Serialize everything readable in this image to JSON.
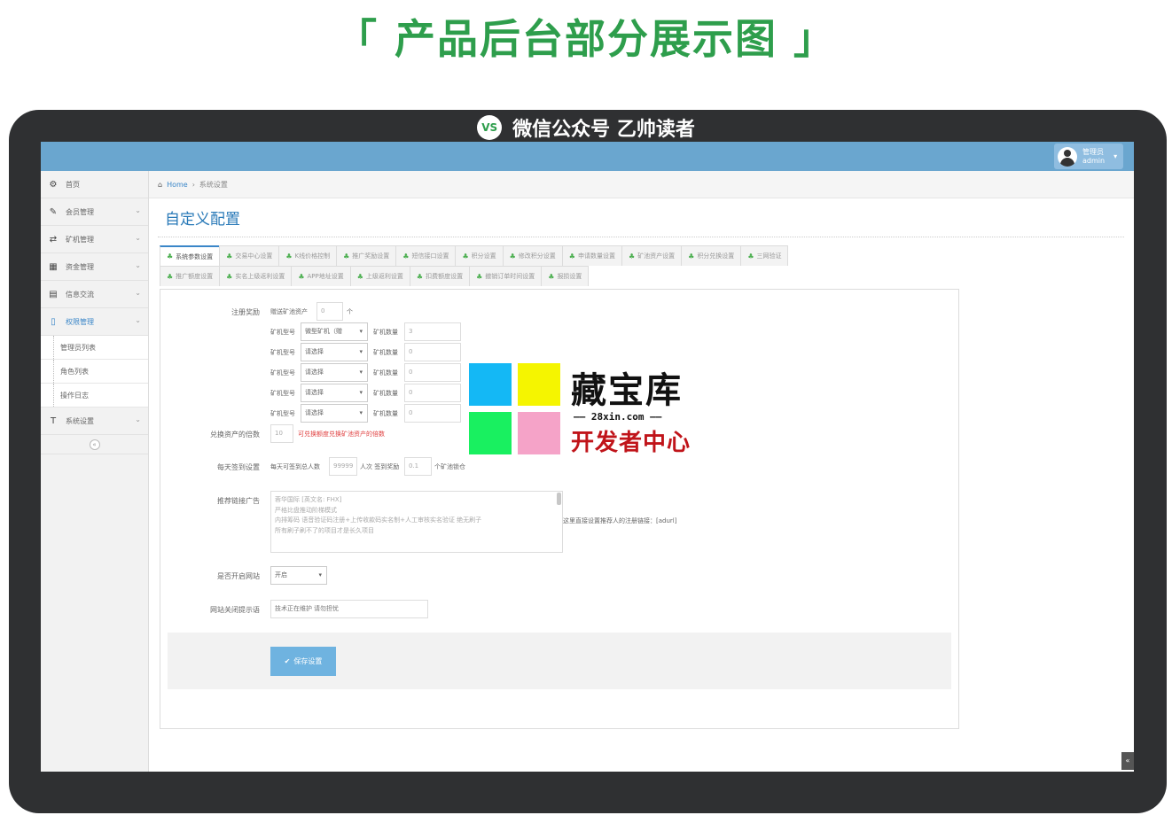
{
  "headline": "「 产品后台部分展示图 」",
  "brand": {
    "logo_text": "VS",
    "name": "微信公众号 乙帅读者"
  },
  "header": {
    "user_role": "管理员",
    "user_name": "admin"
  },
  "sidebar": {
    "items": [
      {
        "label": "首页",
        "icon": "dashboard-icon",
        "glyph": "⚙"
      },
      {
        "label": "会员管理",
        "icon": "edit-icon",
        "glyph": "✎"
      },
      {
        "label": "矿机管理",
        "icon": "shuffle-icon",
        "glyph": "⇄"
      },
      {
        "label": "资金管理",
        "icon": "calendar-icon",
        "glyph": "▦"
      },
      {
        "label": "信息交流",
        "icon": "list-icon",
        "glyph": "▤"
      },
      {
        "label": "权限管理",
        "icon": "file-icon",
        "glyph": "▯"
      },
      {
        "label": "管理员列表"
      },
      {
        "label": "角色列表"
      },
      {
        "label": "操作日志"
      },
      {
        "label": "系统设置",
        "icon": "text-icon",
        "glyph": "T"
      }
    ],
    "collapse_glyph": "«"
  },
  "breadcrumb": {
    "home": "Home",
    "current": "系统设置"
  },
  "page_title": "自定义配置",
  "tabs_row1": [
    "系统参数设置",
    "交易中心设置",
    "K线价格控制",
    "推广奖励设置",
    "短信接口设置",
    "积分设置",
    "修改积分设置",
    "申请数量设置",
    "矿池资产设置",
    "积分兑换设置",
    "三网验证"
  ],
  "tabs_row2": [
    "推广额度设置",
    "实名上级返利设置",
    "APP地址设置",
    "上级返利设置",
    "扣费额度设置",
    "撤销订单时间设置",
    "报损设置"
  ],
  "form": {
    "register_reward_label": "注册奖励",
    "register_gift_text": "赠送矿池资产",
    "register_gift_value": "0",
    "register_gift_unit": "个",
    "miner_type_label": "矿机型号",
    "miner_count_label": "矿机数量",
    "miner_rows": [
      {
        "type": "微型矿机（赠",
        "count": "3"
      },
      {
        "type": "请选择",
        "count": "0"
      },
      {
        "type": "请选择",
        "count": "0"
      },
      {
        "type": "请选择",
        "count": "0"
      },
      {
        "type": "请选择",
        "count": "0"
      }
    ],
    "exchange_label": "兑换资产的倍数",
    "exchange_value": "10",
    "exchange_hint": "可兑换额度兑换矿池资产的倍数",
    "checkin_label": "每天签到设置",
    "checkin_text1": "每天可签到总人数",
    "checkin_people": "99999",
    "checkin_text2": "人次 签到奖励",
    "checkin_reward": "0.1",
    "checkin_text3": "个矿池锁仓",
    "ad_label": "推荐链接广告",
    "ad_lines": [
      "蓉华国际 [英文名: FHX]",
      "严格比盘推动阶梯模式",
      "内排筹码 语音验证码注册+上传收款码实名制+人工审核实名验证 绝无刷子",
      "所有刷子刷不了的项目才是长久项目"
    ],
    "ad_hint": "这里直接设置推荐人的注册链接：[adurl]",
    "site_open_label": "是否开启网站",
    "site_open_value": "开启",
    "close_msg_label": "网站关闭提示语",
    "close_msg_placeholder": "技术正在维护 请勿担忧",
    "save_label": "保存设置"
  },
  "watermark": {
    "main": "藏宝库",
    "url": "—— 28xin.com ——",
    "sub": "开发者中心"
  },
  "colors": {
    "accent": "#3a86c8",
    "topbar": "#6aa6cf",
    "headline": "#2e9e4c",
    "hint": "#e04040"
  }
}
